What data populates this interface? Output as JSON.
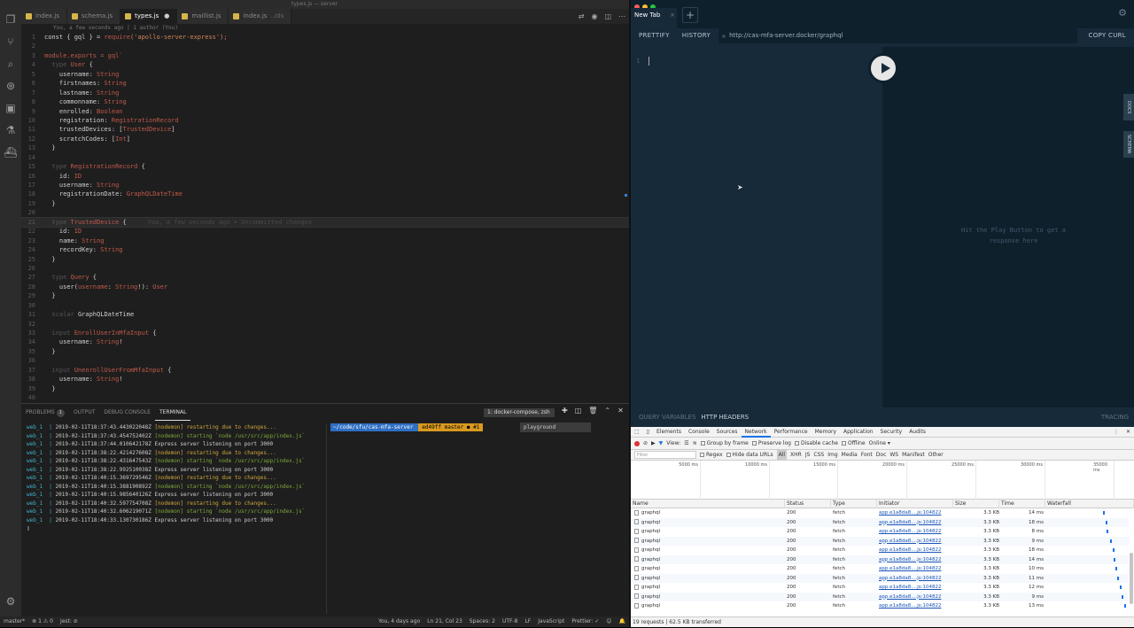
{
  "window_title": "types.js — server",
  "activity_icons": [
    "files-icon",
    "source-control-icon",
    "search-icon",
    "debug-icon",
    "extensions-icon",
    "test-icon",
    "docker-icon"
  ],
  "tabs": [
    {
      "label": "index.js",
      "active": false
    },
    {
      "label": "schema.js",
      "active": false
    },
    {
      "label": "types.js",
      "active": true
    },
    {
      "label": "maillist.js",
      "active": false
    },
    {
      "label": "index.js",
      "suffix": "../ds",
      "active": false
    }
  ],
  "editor": {
    "blame": "You, a few seconds ago | 1 author (You)",
    "inline_blame": "You, a few seconds ago • Uncommitted changes",
    "lines": [
      [
        {
          "t": "const { gql } = ",
          "c": "i"
        },
        {
          "t": "require",
          "c": "tp"
        },
        {
          "t": "('apollo-server-express');",
          "c": "s"
        }
      ],
      [],
      [
        {
          "t": "module.exports = gql`",
          "c": "k"
        }
      ],
      [
        {
          "t": "  type ",
          "c": "dim"
        },
        {
          "t": "User",
          "c": "tp"
        },
        {
          "t": " {",
          "c": "i"
        }
      ],
      [
        {
          "t": "    username: ",
          "c": "i"
        },
        {
          "t": "String",
          "c": "tp"
        }
      ],
      [
        {
          "t": "    firstnames: ",
          "c": "i"
        },
        {
          "t": "String",
          "c": "tp"
        }
      ],
      [
        {
          "t": "    lastname: ",
          "c": "i"
        },
        {
          "t": "String",
          "c": "tp"
        }
      ],
      [
        {
          "t": "    commonname: ",
          "c": "i"
        },
        {
          "t": "String",
          "c": "tp"
        }
      ],
      [
        {
          "t": "    enrolled: ",
          "c": "i"
        },
        {
          "t": "Boolean",
          "c": "tp"
        }
      ],
      [
        {
          "t": "    registration: ",
          "c": "i"
        },
        {
          "t": "RegistrationRecord",
          "c": "tp"
        }
      ],
      [
        {
          "t": "    trustedDevices: [",
          "c": "i"
        },
        {
          "t": "TrustedDevice",
          "c": "tp"
        },
        {
          "t": "]",
          "c": "i"
        }
      ],
      [
        {
          "t": "    scratchCodes: [",
          "c": "i"
        },
        {
          "t": "Int",
          "c": "tp"
        },
        {
          "t": "]",
          "c": "i"
        }
      ],
      [
        {
          "t": "  }",
          "c": "i"
        }
      ],
      [],
      [
        {
          "t": "  type ",
          "c": "dim"
        },
        {
          "t": "RegistrationRecord",
          "c": "tp"
        },
        {
          "t": " {",
          "c": "i"
        }
      ],
      [
        {
          "t": "    id: ",
          "c": "i"
        },
        {
          "t": "ID",
          "c": "tp"
        }
      ],
      [
        {
          "t": "    username: ",
          "c": "i"
        },
        {
          "t": "String",
          "c": "tp"
        }
      ],
      [
        {
          "t": "    registrationDate: ",
          "c": "i"
        },
        {
          "t": "GraphQLDateTime",
          "c": "tp"
        }
      ],
      [
        {
          "t": "  }",
          "c": "i"
        }
      ],
      [],
      [
        {
          "t": "  type ",
          "c": "dim"
        },
        {
          "t": "TrustedDevice",
          "c": "tp"
        },
        {
          "t": " {",
          "c": "i"
        }
      ],
      [
        {
          "t": "    id: ",
          "c": "i"
        },
        {
          "t": "ID",
          "c": "tp"
        }
      ],
      [
        {
          "t": "    name: ",
          "c": "i"
        },
        {
          "t": "String",
          "c": "tp"
        }
      ],
      [
        {
          "t": "    recordKey: ",
          "c": "i"
        },
        {
          "t": "String",
          "c": "tp"
        }
      ],
      [
        {
          "t": "  }",
          "c": "i"
        }
      ],
      [],
      [
        {
          "t": "  type ",
          "c": "dim"
        },
        {
          "t": "Query",
          "c": "tp"
        },
        {
          "t": " {",
          "c": "i"
        }
      ],
      [
        {
          "t": "    user(",
          "c": "i"
        },
        {
          "t": "username",
          "c": "tp"
        },
        {
          "t": ": ",
          "c": "i"
        },
        {
          "t": "String",
          "c": "tp"
        },
        {
          "t": "!): ",
          "c": "i"
        },
        {
          "t": "User",
          "c": "tp"
        }
      ],
      [
        {
          "t": "  }",
          "c": "i"
        }
      ],
      [],
      [
        {
          "t": "  scalar ",
          "c": "dim"
        },
        {
          "t": "GraphQLDateTime",
          "c": "i"
        }
      ],
      [],
      [
        {
          "t": "  input ",
          "c": "dim"
        },
        {
          "t": "EnrollUserInMfaInput",
          "c": "tp"
        },
        {
          "t": " {",
          "c": "i"
        }
      ],
      [
        {
          "t": "    username: ",
          "c": "i"
        },
        {
          "t": "String",
          "c": "tp"
        },
        {
          "t": "!",
          "c": "i"
        }
      ],
      [
        {
          "t": "  }",
          "c": "i"
        }
      ],
      [],
      [
        {
          "t": "  input ",
          "c": "dim"
        },
        {
          "t": "UnenrollUserFromMfaInput",
          "c": "tp"
        },
        {
          "t": " {",
          "c": "i"
        }
      ],
      [
        {
          "t": "    username: ",
          "c": "i"
        },
        {
          "t": "String",
          "c": "tp"
        },
        {
          "t": "!",
          "c": "i"
        }
      ],
      [
        {
          "t": "  }",
          "c": "i"
        }
      ],
      []
    ],
    "highlight_line": 21
  },
  "panel": {
    "tabs": [
      "PROBLEMS",
      "OUTPUT",
      "DEBUG CONSOLE",
      "TERMINAL"
    ],
    "problems_count": "1",
    "terminal_select": "1: docker-compose, zsh",
    "terminal_lines": [
      {
        "pre": "web_1  | ",
        "ts": "2019-02-11T18:37:43.443022048Z",
        "msg": "[nodemon] restarting due to changes...",
        "c": "ty"
      },
      {
        "pre": "web_1  | ",
        "ts": "2019-02-11T18:37:43.454752402Z",
        "msg": "[nodemon] starting `node /usr/src/app/index.js`",
        "c": "tg"
      },
      {
        "pre": "web_1  | ",
        "ts": "2019-02-11T18:37:44.010642178Z",
        "msg": "Express server listening on port 3000",
        "c": "i"
      },
      {
        "pre": "web_1  | ",
        "ts": "2019-02-11T18:38:22.421427608Z",
        "msg": "[nodemon] restarting due to changes...",
        "c": "ty"
      },
      {
        "pre": "web_1  | ",
        "ts": "2019-02-11T18:38:22.431647543Z",
        "msg": "[nodemon] starting `node /usr/src/app/index.js`",
        "c": "tg"
      },
      {
        "pre": "web_1  | ",
        "ts": "2019-02-11T18:38:22.992510038Z",
        "msg": "Express server listening on port 3000",
        "c": "i"
      },
      {
        "pre": "web_1  | ",
        "ts": "2019-02-11T18:40:15.369729546Z",
        "msg": "[nodemon] restarting due to changes...",
        "c": "ty"
      },
      {
        "pre": "web_1  | ",
        "ts": "2019-02-11T18:40:15.388190892Z",
        "msg": "[nodemon] starting `node /usr/src/app/index.js`",
        "c": "tg"
      },
      {
        "pre": "web_1  | ",
        "ts": "2019-02-11T18:40:15.985640126Z",
        "msg": "Express server listening on port 3000",
        "c": "i"
      },
      {
        "pre": "web_1  | ",
        "ts": "2019-02-11T18:40:32.597754708Z",
        "msg": "[nodemon] restarting due to changes...",
        "c": "ty"
      },
      {
        "pre": "web_1  | ",
        "ts": "2019-02-11T18:40:32.606219071Z",
        "msg": "[nodemon] starting `node /usr/src/app/index.js`",
        "c": "tg"
      },
      {
        "pre": "web_1  | ",
        "ts": "2019-02-11T18:40:33.130730186Z",
        "msg": "Express server listening on port 3000",
        "c": "i"
      }
    ],
    "prompt_path": "~/code/sfu/cas-mfa-server",
    "prompt_git": "ed49ff  master ● #1",
    "find_value": "playground"
  },
  "statusbar": {
    "left": [
      "master*",
      "⊗ 1 ⚠ 0",
      "Jest: ⊘"
    ],
    "right": [
      "You, 4 days ago",
      "Ln 21, Col 23",
      "Spaces: 2",
      "UTF-8",
      "LF",
      "JavaScript",
      "Prettier: ✓"
    ]
  },
  "playground": {
    "tab_label": "New Tab",
    "buttons": [
      "PRETTIFY",
      "HISTORY"
    ],
    "url": "http://cas-mfa-server.docker/graphql",
    "copy_curl": "COPY CURL",
    "query_line_no": "1",
    "hint": "Hit the Play Button to get a response here",
    "side_tabs": [
      "DOCS",
      "SCHEMA"
    ],
    "bottom_tabs": [
      "QUERY VARIABLES",
      "HTTP HEADERS"
    ],
    "tracing": "TRACING"
  },
  "devtools": {
    "tabs": [
      "Elements",
      "Console",
      "Sources",
      "Network",
      "Performance",
      "Memory",
      "Application",
      "Security",
      "Audits"
    ],
    "active_tab": "Network",
    "toolbar": {
      "view": "View:",
      "group_by_frame": "Group by frame",
      "preserve_log": "Preserve log",
      "disable_cache": "Disable cache",
      "offline": "Offline",
      "online": "Online"
    },
    "filter": {
      "placeholder": "Filter",
      "regex": "Regex",
      "hide_data_urls": "Hide data URLs",
      "types": [
        "All",
        "XHR",
        "JS",
        "CSS",
        "Img",
        "Media",
        "Font",
        "Doc",
        "WS",
        "Manifest",
        "Other"
      ]
    },
    "ticks": [
      "5000 ms",
      "10000 ms",
      "15000 ms",
      "20000 ms",
      "25000 ms",
      "30000 ms",
      "35000 ms"
    ],
    "columns": [
      "Name",
      "Status",
      "Type",
      "Initiator",
      "Size",
      "Time",
      "Waterfall"
    ],
    "rows": [
      {
        "name": "graphql",
        "status": "200",
        "type": "fetch",
        "initiator": "app.e1a8da8....js:104822",
        "size": "3.3 KB",
        "time": "14 ms",
        "wf": 0.72
      },
      {
        "name": "graphql",
        "status": "200",
        "type": "fetch",
        "initiator": "app.e1a8da8....js:104822",
        "size": "3.3 KB",
        "time": "18 ms",
        "wf": 0.75
      },
      {
        "name": "graphql",
        "status": "200",
        "type": "fetch",
        "initiator": "app.e1a8da8....js:104822",
        "size": "3.3 KB",
        "time": "8 ms",
        "wf": 0.77
      },
      {
        "name": "graphql",
        "status": "200",
        "type": "fetch",
        "initiator": "app.e1a8da8....js:104822",
        "size": "3.3 KB",
        "time": "9 ms",
        "wf": 0.81
      },
      {
        "name": "graphql",
        "status": "200",
        "type": "fetch",
        "initiator": "app.e1a8da8....js:104822",
        "size": "3.3 KB",
        "time": "18 ms",
        "wf": 0.84
      },
      {
        "name": "graphql",
        "status": "200",
        "type": "fetch",
        "initiator": "app.e1a8da8....js:104822",
        "size": "3.3 KB",
        "time": "14 ms",
        "wf": 0.86
      },
      {
        "name": "graphql",
        "status": "200",
        "type": "fetch",
        "initiator": "app.e1a8da8....js:104822",
        "size": "3.3 KB",
        "time": "10 ms",
        "wf": 0.88
      },
      {
        "name": "graphql",
        "status": "200",
        "type": "fetch",
        "initiator": "app.e1a8da8....js:104822",
        "size": "3.3 KB",
        "time": "11 ms",
        "wf": 0.9
      },
      {
        "name": "graphql",
        "status": "200",
        "type": "fetch",
        "initiator": "app.e1a8da8....js:104822",
        "size": "3.3 KB",
        "time": "12 ms",
        "wf": 0.93
      },
      {
        "name": "graphql",
        "status": "200",
        "type": "fetch",
        "initiator": "app.e1a8da8....js:104822",
        "size": "3.3 KB",
        "time": "9 ms",
        "wf": 0.96
      },
      {
        "name": "graphql",
        "status": "200",
        "type": "fetch",
        "initiator": "app.e1a8da8....js:104822",
        "size": "3.3 KB",
        "time": "13 ms",
        "wf": 0.99
      }
    ],
    "status": "19 requests | 62.5 KB transferred"
  }
}
